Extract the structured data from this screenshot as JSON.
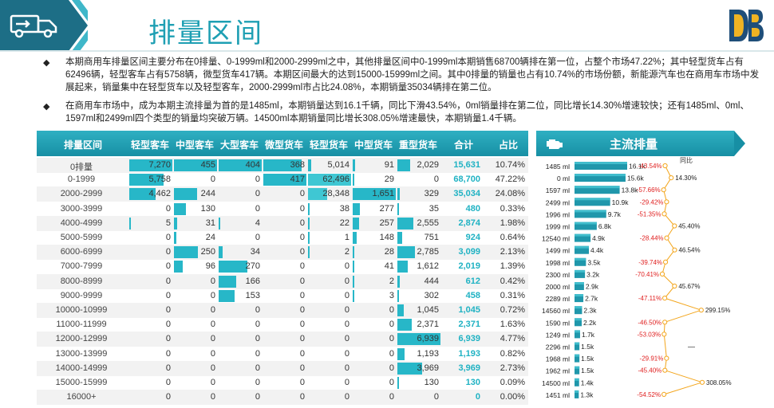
{
  "page": {
    "title": "排量区间"
  },
  "bullets": [
    "本期商用车排量区间主要分布在0排量、0-1999ml和2000-2999ml之中，其他排量区间中0-1999ml本期销售68700辆排在第一位，占整个市场47.22%；其中轻型货车占有62496辆，轻型客车占有5758辆，微型货车417辆。本期区间最大的达到15000-15999ml之间。其中0排量的销量也占有10.74%的市场份额，新能源汽车也在商用车市场中发展起来，销量集中在轻型货车以及轻型客车，2000-2999ml市占比24.08%，本期销量35034辆排在第二位。",
    "在商用车市场中，成为本期主流排量为首的是1485ml，本期销量达到16.1千辆，同比下滑43.54%，0ml销量排在第二位，同比增长14.30%增速较快；还有1485ml、0ml、1597ml和2499ml四个类型的销量均突破万辆。14500ml本期销量同比增长308.05%增速最快，本期销量1.4千辆。"
  ],
  "chart_data": [
    {
      "type": "table",
      "columns": [
        "排量区间",
        "轻型客车",
        "中型客车",
        "大型客车",
        "微型货车",
        "轻型货车",
        "中型货车",
        "重型货车",
        "合计",
        "占比"
      ],
      "rows": [
        [
          "0排量",
          7270,
          455,
          404,
          368,
          5014,
          91,
          2029,
          15631,
          "10.74%"
        ],
        [
          "0-1999",
          5758,
          0,
          0,
          417,
          62496,
          29,
          0,
          68700,
          "47.22%"
        ],
        [
          "2000-2999",
          4462,
          244,
          0,
          0,
          28348,
          1651,
          329,
          35034,
          "24.08%"
        ],
        [
          "3000-3999",
          0,
          130,
          0,
          0,
          38,
          277,
          35,
          480,
          "0.33%"
        ],
        [
          "4000-4999",
          5,
          31,
          4,
          0,
          22,
          257,
          2555,
          2874,
          "1.98%"
        ],
        [
          "5000-5999",
          0,
          24,
          0,
          0,
          1,
          148,
          751,
          924,
          "0.64%"
        ],
        [
          "6000-6999",
          0,
          250,
          34,
          0,
          2,
          28,
          2785,
          3099,
          "2.13%"
        ],
        [
          "7000-7999",
          0,
          96,
          270,
          0,
          0,
          41,
          1612,
          2019,
          "1.39%"
        ],
        [
          "8000-8999",
          0,
          0,
          166,
          0,
          0,
          2,
          444,
          612,
          "0.42%"
        ],
        [
          "9000-9999",
          0,
          0,
          153,
          0,
          0,
          3,
          302,
          458,
          "0.31%"
        ],
        [
          "10000-10999",
          0,
          0,
          0,
          0,
          0,
          0,
          1045,
          1045,
          "0.72%"
        ],
        [
          "11000-11999",
          0,
          0,
          0,
          0,
          0,
          0,
          2371,
          2371,
          "1.63%"
        ],
        [
          "12000-12999",
          0,
          0,
          0,
          0,
          0,
          0,
          6939,
          6939,
          "4.77%"
        ],
        [
          "13000-13999",
          0,
          0,
          0,
          0,
          0,
          0,
          1193,
          1193,
          "0.82%"
        ],
        [
          "14000-14999",
          0,
          0,
          0,
          0,
          0,
          0,
          3969,
          3969,
          "2.73%"
        ],
        [
          "15000-15999",
          0,
          0,
          0,
          0,
          0,
          0,
          130,
          130,
          "0.09%"
        ],
        [
          "16000+",
          0,
          0,
          0,
          0,
          0,
          0,
          0,
          0,
          "0.00%"
        ]
      ],
      "formatted_rows": [
        [
          "0排量",
          "7,270",
          "455",
          "404",
          "368",
          "5,014",
          "91",
          "2,029",
          "15,631",
          "10.74%"
        ],
        [
          "0-1999",
          "5,758",
          "0",
          "0",
          "417",
          "62,496",
          "29",
          "0",
          "68,700",
          "47.22%"
        ],
        [
          "2000-2999",
          "4,462",
          "244",
          "0",
          "0",
          "28,348",
          "1,651",
          "329",
          "35,034",
          "24.08%"
        ],
        [
          "3000-3999",
          "0",
          "130",
          "0",
          "0",
          "38",
          "277",
          "35",
          "480",
          "0.33%"
        ],
        [
          "4000-4999",
          "5",
          "31",
          "4",
          "0",
          "22",
          "257",
          "2,555",
          "2,874",
          "1.98%"
        ],
        [
          "5000-5999",
          "0",
          "24",
          "0",
          "0",
          "1",
          "148",
          "751",
          "924",
          "0.64%"
        ],
        [
          "6000-6999",
          "0",
          "250",
          "34",
          "0",
          "2",
          "28",
          "2,785",
          "3,099",
          "2.13%"
        ],
        [
          "7000-7999",
          "0",
          "96",
          "270",
          "0",
          "0",
          "41",
          "1,612",
          "2,019",
          "1.39%"
        ],
        [
          "8000-8999",
          "0",
          "0",
          "166",
          "0",
          "0",
          "2",
          "444",
          "612",
          "0.42%"
        ],
        [
          "9000-9999",
          "0",
          "0",
          "153",
          "0",
          "0",
          "3",
          "302",
          "458",
          "0.31%"
        ],
        [
          "10000-10999",
          "0",
          "0",
          "0",
          "0",
          "0",
          "0",
          "1,045",
          "1,045",
          "0.72%"
        ],
        [
          "11000-11999",
          "0",
          "0",
          "0",
          "0",
          "0",
          "0",
          "2,371",
          "2,371",
          "1.63%"
        ],
        [
          "12000-12999",
          "0",
          "0",
          "0",
          "0",
          "0",
          "0",
          "6,939",
          "6,939",
          "4.77%"
        ],
        [
          "13000-13999",
          "0",
          "0",
          "0",
          "0",
          "0",
          "0",
          "1,193",
          "1,193",
          "0.82%"
        ],
        [
          "14000-14999",
          "0",
          "0",
          "0",
          "0",
          "0",
          "0",
          "3,969",
          "3,969",
          "2.73%"
        ],
        [
          "15000-15999",
          "0",
          "0",
          "0",
          "0",
          "0",
          "0",
          "130",
          "130",
          "0.09%"
        ],
        [
          "16000+",
          "0",
          "0",
          "0",
          "0",
          "0",
          "0",
          "0",
          "0",
          "0.00%"
        ]
      ],
      "bar_color": "#27b7c8",
      "total_color": "#1fb2c3"
    },
    {
      "type": "bar",
      "title": "主流排量",
      "categories": [
        "1485 ml",
        "0 ml",
        "1597 ml",
        "2499 ml",
        "1996 ml",
        "1999 ml",
        "12540 ml",
        "1499 ml",
        "1998 ml",
        "2300 ml",
        "2000 ml",
        "2289 ml",
        "14560 ml",
        "1590 ml",
        "1249 ml",
        "2296 ml",
        "1968 ml",
        "1962 ml",
        "14500 ml",
        "1451 ml"
      ],
      "values": [
        16.1,
        15.6,
        13.8,
        10.9,
        9.7,
        6.8,
        4.9,
        4.4,
        3.5,
        3.2,
        2.9,
        2.7,
        2.3,
        2.2,
        1.7,
        1.5,
        1.5,
        1.5,
        1.4,
        1.3
      ],
      "value_labels": [
        "16.1k",
        "15.6k",
        "13.8k",
        "10.9k",
        "9.7k",
        "6.8k",
        "4.9k",
        "4.4k",
        "3.5k",
        "3.2k",
        "2.9k",
        "2.7k",
        "2.3k",
        "2.2k",
        "1.7k",
        "1.5k",
        "1.5k",
        "1.5k",
        "1.4k",
        "1.3k"
      ],
      "color": "#1a8fa3"
    },
    {
      "type": "line",
      "title": "同比",
      "categories": [
        "1485 ml",
        "0 ml",
        "1597 ml",
        "2499 ml",
        "1996 ml",
        "1999 ml",
        "12540 ml",
        "1499 ml",
        "1998 ml",
        "2300 ml",
        "2000 ml",
        "2289 ml",
        "14560 ml",
        "1590 ml",
        "1249 ml",
        "2296 ml",
        "1968 ml",
        "1962 ml",
        "14500 ml",
        "1451 ml"
      ],
      "values": [
        -43.54,
        14.3,
        -57.66,
        -29.42,
        -51.35,
        45.4,
        -28.44,
        46.54,
        -39.74,
        -70.41,
        45.67,
        -47.11,
        299.15,
        -46.5,
        -53.03,
        null,
        -29.91,
        -45.4,
        308.05,
        -54.52
      ],
      "labels": [
        "-43.54%",
        "14.30%",
        "-57.66%",
        "-29.42%",
        "-51.35%",
        "45.40%",
        "-28.44%",
        "46.54%",
        "-39.74%",
        "-70.41%",
        "45.67%",
        "-47.11%",
        "299.15%",
        "-46.50%",
        "-53.03%",
        "—",
        "-29.91%",
        "-45.40%",
        "308.05%",
        "-54.52%"
      ],
      "line_color": "#f3a51b",
      "negative_label_color": "#e02020"
    }
  ]
}
